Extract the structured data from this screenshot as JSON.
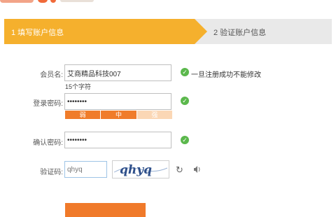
{
  "steps": [
    {
      "label": "1 填写账户信息"
    },
    {
      "label": "2 验证账户信息"
    }
  ],
  "form": {
    "member_label": "会员名:",
    "member_value": "艾商精品科技007",
    "member_note": "一旦注册成功不能修改",
    "member_subhint": "15个字符",
    "password_label": "登录密码:",
    "password_value": "••••••••",
    "strength": {
      "weak": "弱",
      "medium": "中",
      "strong": "强",
      "level": 2
    },
    "confirm_label": "确认密码:",
    "confirm_value": "••••••••",
    "captcha_label": "验证码:",
    "captcha_value": "qhyq",
    "captcha_image_text": "qhyq"
  },
  "icons": {
    "check": "check-icon",
    "refresh": "refresh-icon",
    "audio": "speaker-icon"
  },
  "colors": {
    "accent": "#f5b02d",
    "success": "#5bb84c",
    "strength": "#f07c2a",
    "submit": "#f07a2a"
  }
}
